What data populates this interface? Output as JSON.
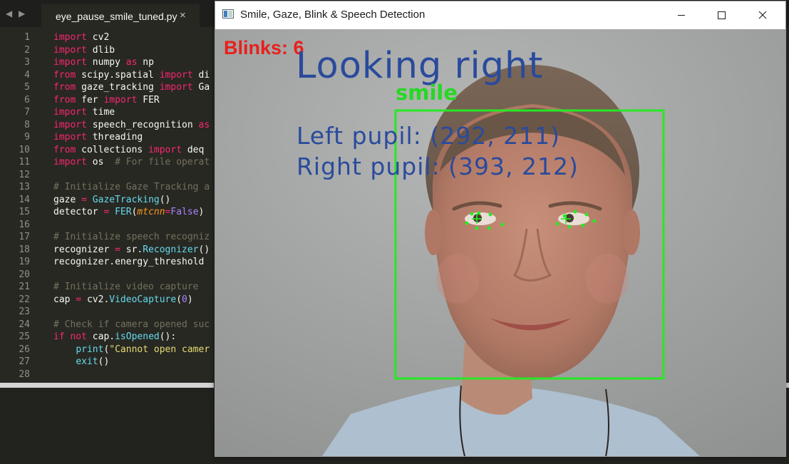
{
  "editor": {
    "tab_title": "eye_pause_smile_tuned.py",
    "tab_close": "×",
    "nav_back": "◀",
    "nav_forward": "▶",
    "line_numbers": [
      "1",
      "2",
      "3",
      "4",
      "5",
      "6",
      "7",
      "8",
      "9",
      "10",
      "11",
      "12",
      "13",
      "14",
      "15",
      "16",
      "17",
      "18",
      "19",
      "20",
      "21",
      "22",
      "23",
      "24",
      "25",
      "26",
      "27",
      "28"
    ],
    "lines": [
      [
        [
          "k",
          "import"
        ],
        [
          "t",
          " cv2"
        ]
      ],
      [
        [
          "k",
          "import"
        ],
        [
          "t",
          " dlib"
        ]
      ],
      [
        [
          "k",
          "import"
        ],
        [
          "t",
          " numpy "
        ],
        [
          "k",
          "as"
        ],
        [
          "t",
          " np"
        ]
      ],
      [
        [
          "k",
          "from"
        ],
        [
          "t",
          " scipy.spatial "
        ],
        [
          "k",
          "import"
        ],
        [
          "t",
          " di"
        ]
      ],
      [
        [
          "k",
          "from"
        ],
        [
          "t",
          " gaze_tracking "
        ],
        [
          "k",
          "import"
        ],
        [
          "t",
          " Ga"
        ]
      ],
      [
        [
          "k",
          "from"
        ],
        [
          "t",
          " fer "
        ],
        [
          "k",
          "import"
        ],
        [
          "t",
          " FER"
        ]
      ],
      [
        [
          "k",
          "import"
        ],
        [
          "t",
          " time"
        ]
      ],
      [
        [
          "k",
          "import"
        ],
        [
          "t",
          " speech_recognition "
        ],
        [
          "k",
          "as"
        ]
      ],
      [
        [
          "k",
          "import"
        ],
        [
          "t",
          " threading"
        ]
      ],
      [
        [
          "k",
          "from"
        ],
        [
          "t",
          " collections "
        ],
        [
          "k",
          "import"
        ],
        [
          "t",
          " deq"
        ]
      ],
      [
        [
          "k",
          "import"
        ],
        [
          "t",
          " os  "
        ],
        [
          "c",
          "# For file operat"
        ]
      ],
      [],
      [
        [
          "c",
          "# Initialize Gaze Tracking a"
        ]
      ],
      [
        [
          "t",
          "gaze "
        ],
        [
          "k",
          "="
        ],
        [
          "t",
          " "
        ],
        [
          "f",
          "GazeTracking"
        ],
        [
          "t",
          "()"
        ]
      ],
      [
        [
          "t",
          "detector "
        ],
        [
          "k",
          "="
        ],
        [
          "t",
          " "
        ],
        [
          "f",
          "FER"
        ],
        [
          "t",
          "("
        ],
        [
          "p",
          "mtcnn"
        ],
        [
          "k",
          "="
        ],
        [
          "n",
          "False"
        ],
        [
          "t",
          ")"
        ]
      ],
      [],
      [
        [
          "c",
          "# Initialize speech recogniz"
        ]
      ],
      [
        [
          "t",
          "recognizer "
        ],
        [
          "k",
          "="
        ],
        [
          "t",
          " sr."
        ],
        [
          "f",
          "Recognizer"
        ],
        [
          "t",
          "()"
        ]
      ],
      [
        [
          "t",
          "recognizer.energy_threshold"
        ]
      ],
      [],
      [
        [
          "c",
          "# Initialize video capture"
        ]
      ],
      [
        [
          "t",
          "cap "
        ],
        [
          "k",
          "="
        ],
        [
          "t",
          " cv2."
        ],
        [
          "f",
          "VideoCapture"
        ],
        [
          "t",
          "("
        ],
        [
          "n",
          "0"
        ],
        [
          "t",
          ")"
        ]
      ],
      [],
      [
        [
          "c",
          "# Check if camera opened suc"
        ]
      ],
      [
        [
          "k",
          "if"
        ],
        [
          "t",
          " "
        ],
        [
          "k",
          "not"
        ],
        [
          "t",
          " cap."
        ],
        [
          "f",
          "isOpened"
        ],
        [
          "t",
          "():"
        ]
      ],
      [
        [
          "t",
          "    "
        ],
        [
          "f",
          "print"
        ],
        [
          "t",
          "("
        ],
        [
          "s",
          "\"Cannot open camer"
        ]
      ],
      [
        [
          "t",
          "    "
        ],
        [
          "f",
          "exit"
        ],
        [
          "t",
          "()"
        ]
      ],
      []
    ]
  },
  "window": {
    "title": "Smile, Gaze, Blink & Speech Detection",
    "controls": [
      "minimize-icon",
      "maximize-icon",
      "close-icon"
    ]
  },
  "overlay": {
    "blinks": "Blinks: 6",
    "gaze": "Looking right",
    "emotion": "smile",
    "left_pupil": "Left pupil:  (292, 211)",
    "right_pupil": "Right pupil: (393, 212)"
  },
  "colors": {
    "blink_text": "#e8201c",
    "gaze_text": "#2a4a9c",
    "face_box": "#27e824",
    "landmarks": "#22ee22",
    "editor_bg": "#272822",
    "keyword": "#f92672",
    "function": "#66d9ef",
    "comment": "#75715e"
  }
}
